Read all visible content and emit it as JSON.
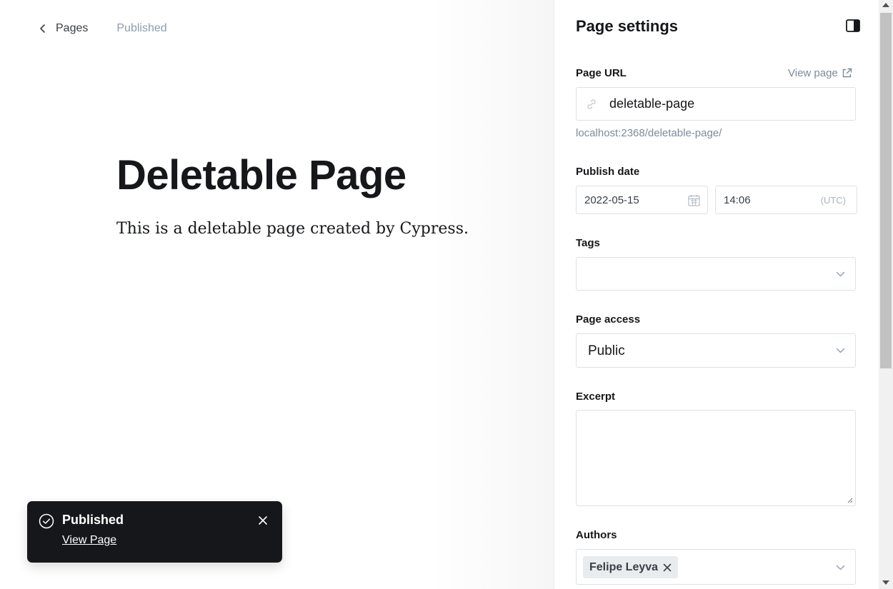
{
  "editor": {
    "back_label": "Pages",
    "status": "Published",
    "title": "Deletable Page",
    "body": "This is a deletable page created by Cypress."
  },
  "toast": {
    "title": "Published",
    "link": "View Page"
  },
  "settings": {
    "title": "Page settings",
    "url": {
      "label": "Page URL",
      "view_page": "View page",
      "value": "deletable-page",
      "hint": "localhost:2368/deletable-page/"
    },
    "publish_date": {
      "label": "Publish date",
      "date": "2022-05-15",
      "time": "14:06",
      "timezone": "(UTC)"
    },
    "tags": {
      "label": "Tags"
    },
    "access": {
      "label": "Page access",
      "value": "Public"
    },
    "excerpt": {
      "label": "Excerpt",
      "value": ""
    },
    "authors": {
      "label": "Authors",
      "items": [
        "Felipe Leyva"
      ]
    }
  },
  "icons": {
    "back": "chevron-left-icon",
    "toast_status": "check-circle-icon",
    "toast_close": "close-icon",
    "panel_toggle": "sidebar-toggle-icon",
    "external": "external-link-icon",
    "url": "link-icon",
    "calendar": "calendar-icon",
    "dropdown": "chevron-down-icon"
  },
  "colors": {
    "toast_bg": "#15171a",
    "muted_text": "#7c8b9a",
    "border": "#dde1e5",
    "chip_bg": "#e9ecef"
  }
}
